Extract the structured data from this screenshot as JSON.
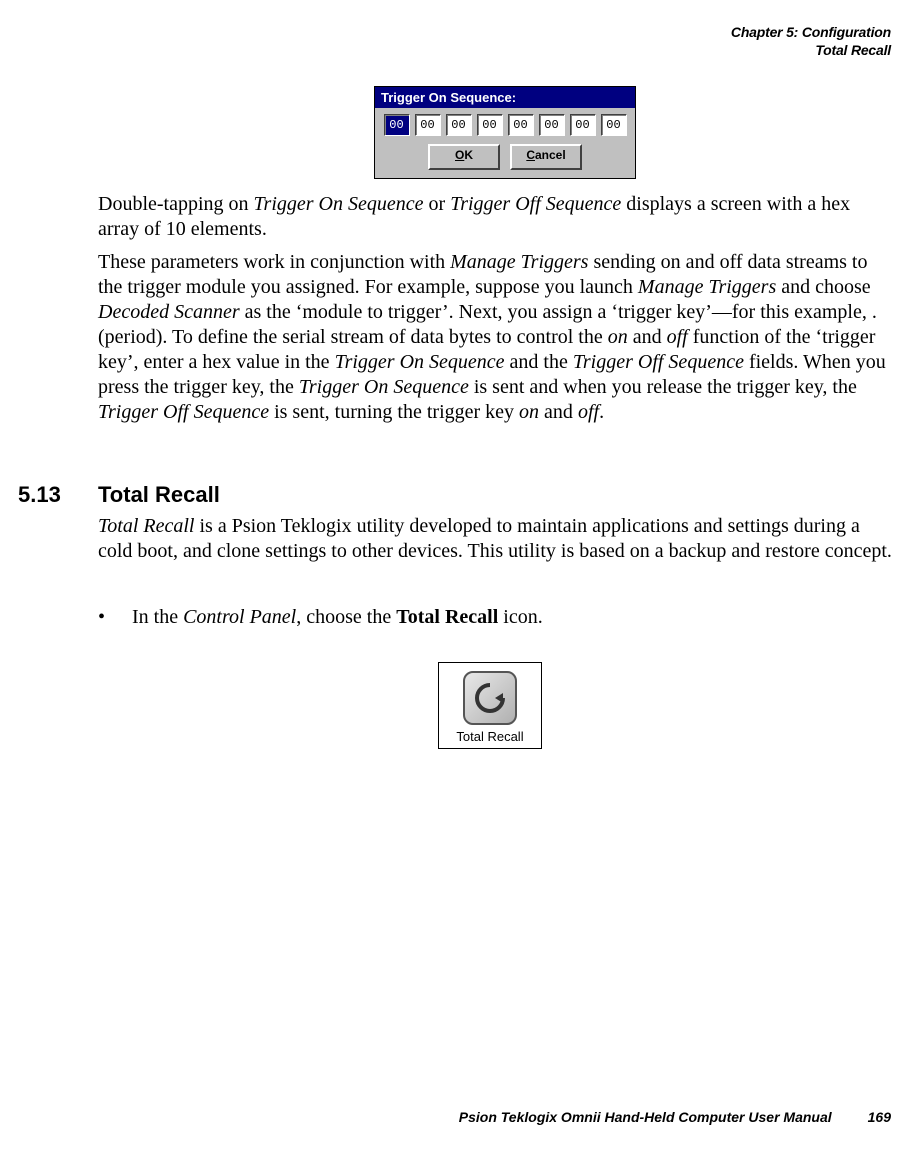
{
  "header": {
    "chapter": "Chapter 5: Configuration",
    "section": "Total Recall"
  },
  "dialog": {
    "title": "Trigger On Sequence:",
    "hex": [
      "00",
      "00",
      "00",
      "00",
      "00",
      "00",
      "00",
      "00"
    ],
    "ok": "OK",
    "ok_ul": "O",
    "ok_rest": "K",
    "cancel_ul": "C",
    "cancel_rest": "ancel"
  },
  "para1": {
    "pre": "Double-tapping on ",
    "i1": "Trigger On Sequence",
    "mid": " or ",
    "i2": "Trigger Off Sequence",
    "post": " displays a screen with a hex array of 10 elements."
  },
  "para2": {
    "t1": "These parameters work in conjunction with ",
    "i1": "Manage Triggers",
    "t2": " sending on and off data streams to the trigger module you assigned. For example, suppose you launch ",
    "i2": "Manage Trig­gers",
    "t3": " and choose ",
    "i3": "Decoded Scanner",
    "t4": " as the ‘module to trigger’. Next, you assign a ‘trigger key’—for this example, . (period). To define the serial stream of data bytes to control the ",
    "i4": "on",
    "t5": " and ",
    "i5": "off",
    "t6": " function of the ‘trigger key’, enter a hex value in the ",
    "i6": "Trigger On Sequence",
    "t7": " and the ",
    "i7": "Trigger Off Sequence",
    "t8": " fields. When you press the trigger key, the ",
    "i8": "Trigger On Sequence",
    "t9": " is sent and when you release the trigger key, the ",
    "i9": "Trigger Off Sequence",
    "t10": " is sent, turning the trigger key ",
    "i10": "on",
    "t11": " and ",
    "i11": "off",
    "t12": "."
  },
  "heading": {
    "num": "5.13",
    "title": "Total Recall"
  },
  "para3": {
    "i1": "Total Recall",
    "t1": " is a Psion Teklogix utility developed to maintain applications and settings during a cold boot, and clone settings to other devices. This utility is based on a backup and restore concept."
  },
  "bullet": {
    "dot": "•",
    "t1": "In the ",
    "i1": "Control Panel",
    "t2": ", choose the ",
    "b1": "Total Recall",
    "t3": " icon."
  },
  "icon": {
    "label": "Total Recall"
  },
  "footer": {
    "text": "Psion Teklogix Omnii Hand-Held Computer User Manual",
    "page": "169"
  }
}
